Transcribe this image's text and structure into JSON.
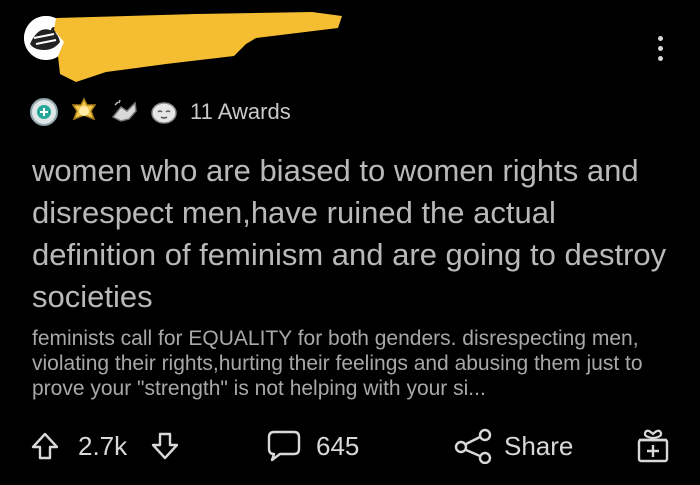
{
  "post": {
    "awards_label": "11 Awards",
    "title": "women who are biased to women rights and disrespect men,have ruined the actual definition of feminism and are going to destroy societies",
    "body": "feminists call for EQUALITY for both genders. disrespecting men, violating their rights,hurting their feelings and abusing them just to prove your \"strength\" is not helping with your si..."
  },
  "actions": {
    "votes": "2.7k",
    "comments": "645",
    "share_label": "Share"
  },
  "icons": {
    "upvote": "arrow-up-outline-icon",
    "downvote": "arrow-down-outline-icon",
    "comment": "speech-bubble-icon",
    "share": "share-nodes-icon",
    "gift": "gift-box-icon",
    "more": "vertical-ellipsis-icon"
  },
  "colors": {
    "background": "#000000",
    "redaction": "#f5bd32",
    "title_text": "#b9b9b9",
    "body_text": "#a8a8a8"
  }
}
